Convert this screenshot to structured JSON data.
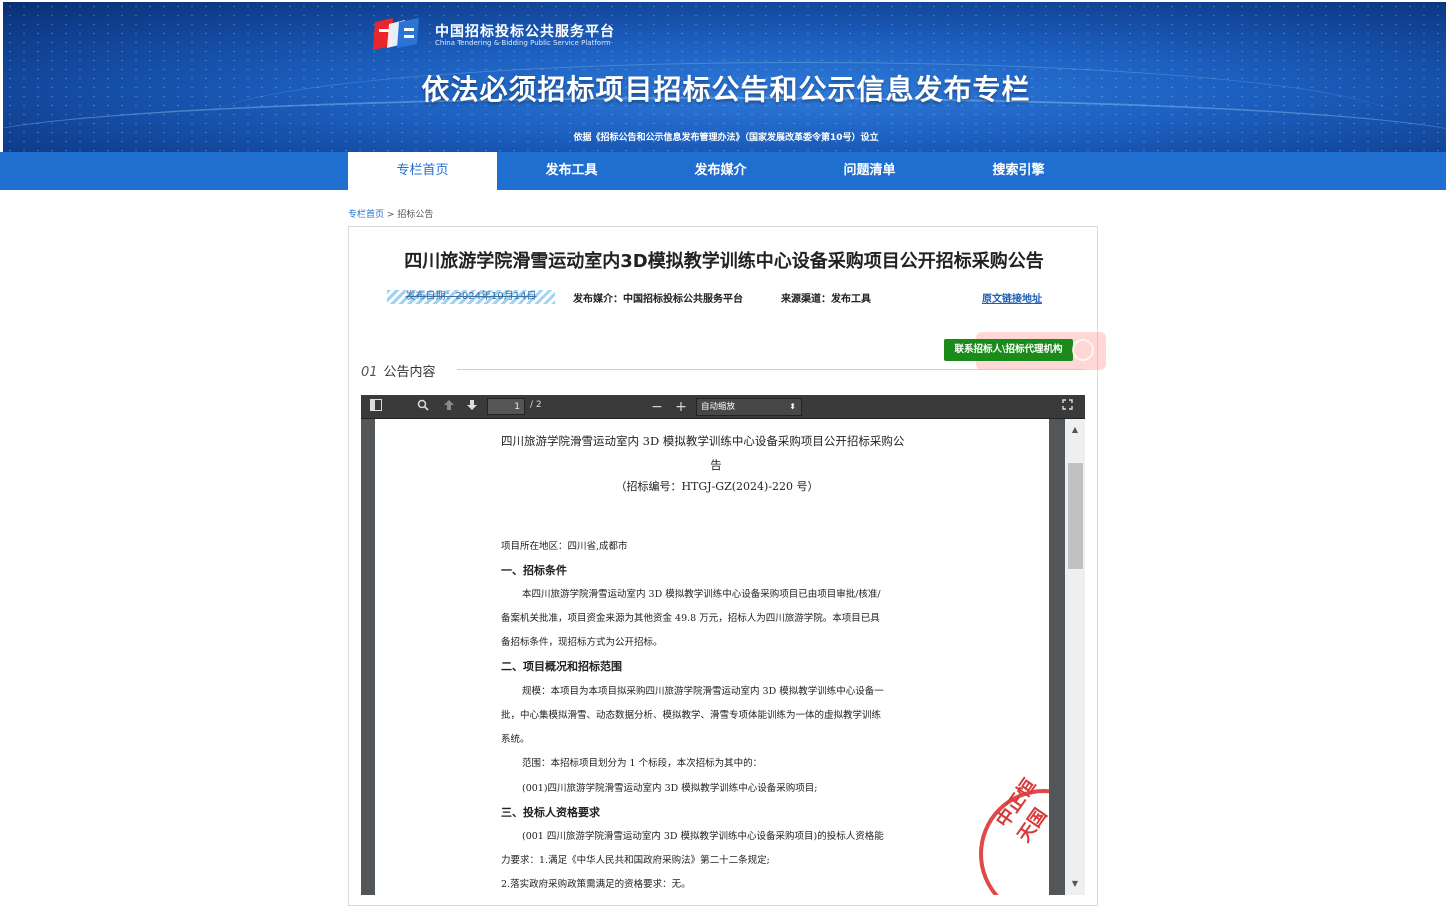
{
  "header": {
    "logo_cn": "中国招标投标公共服务平台",
    "logo_en": "China Tendering & Bidding Public Service Platform",
    "title": "依法必须招标项目招标公告和公示信息发布专栏",
    "subtitle": "依据《招标公告和公示信息发布管理办法》（国家发展改革委令第10号）设立"
  },
  "nav": {
    "items": [
      {
        "label": "专栏首页",
        "active": true
      },
      {
        "label": "发布工具",
        "active": false
      },
      {
        "label": "发布媒介",
        "active": false
      },
      {
        "label": "问题清单",
        "active": false
      },
      {
        "label": "搜索引擎",
        "active": false
      }
    ]
  },
  "breadcrumb": {
    "home": "专栏首页",
    "sep": ">",
    "current": "招标公告"
  },
  "notice": {
    "title": "四川旅游学院滑雪运动室内3D模拟教学训练中心设备采购项目公开招标采购公告",
    "publish_date": "发布日期：2024年10月14日",
    "media": "发布媒介：中国招标投标公共服务平台",
    "source": "来源渠道：发布工具",
    "original_link": "原文链接地址",
    "contact_button": "联系招标人\\招标代理机构",
    "section_num": "01",
    "section_label": "公告内容"
  },
  "viewer": {
    "page_current": "1",
    "page_total": "/ 2",
    "zoom": "自动缩放",
    "colors": {
      "toolbar": "#3a3a3a",
      "background": "#525659"
    }
  },
  "pdf": {
    "title_line1": "四川旅游学院滑雪运动室内 3D 模拟教学训练中心设备采购项目公开招标采购公",
    "title_line2": "告",
    "code": "（招标编号：HTGJ-GZ(2024)-220 号）",
    "region": "项目所在地区：四川省,成都市",
    "h1": "一、招标条件",
    "p1a": "本四川旅游学院滑雪运动室内 3D 模拟教学训练中心设备采购项目已由项目审批/核准/",
    "p1b": "备案机关批准，项目资金来源为其他资金 49.8 万元，招标人为四川旅游学院。本项目已具",
    "p1c": "备招标条件，现招标方式为公开招标。",
    "h2": "二、项目概况和招标范围",
    "p2a": "规模：本项目为本项目拟采购四川旅游学院滑雪运动室内 3D 模拟教学训练中心设备一",
    "p2b": "批，中心集模拟滑雪、动态数据分析、模拟教学、滑雪专项体能训练为一体的虚拟教学训练",
    "p2c": "系统。",
    "p2d": "范围：本招标项目划分为 1 个标段，本次招标为其中的：",
    "p2e": "(001)四川旅游学院滑雪运动室内 3D 模拟教学训练中心设备采购项目;",
    "h3": "三、投标人资格要求",
    "p3a": "(001 四川旅游学院滑雪运动室内 3D 模拟教学训练中心设备采购项目)的投标人资格能",
    "p3b": "力要求：1.满足《中华人民共和国政府采购法》第二十二条规定;",
    "p3c": "2.落实政府采购政策需满足的资格要求：无。",
    "stamp": "中正恒天国"
  },
  "colors": {
    "nav": "#1f6fd0",
    "contact_button": "#1a8a1a",
    "link": "#1f5fb8"
  }
}
